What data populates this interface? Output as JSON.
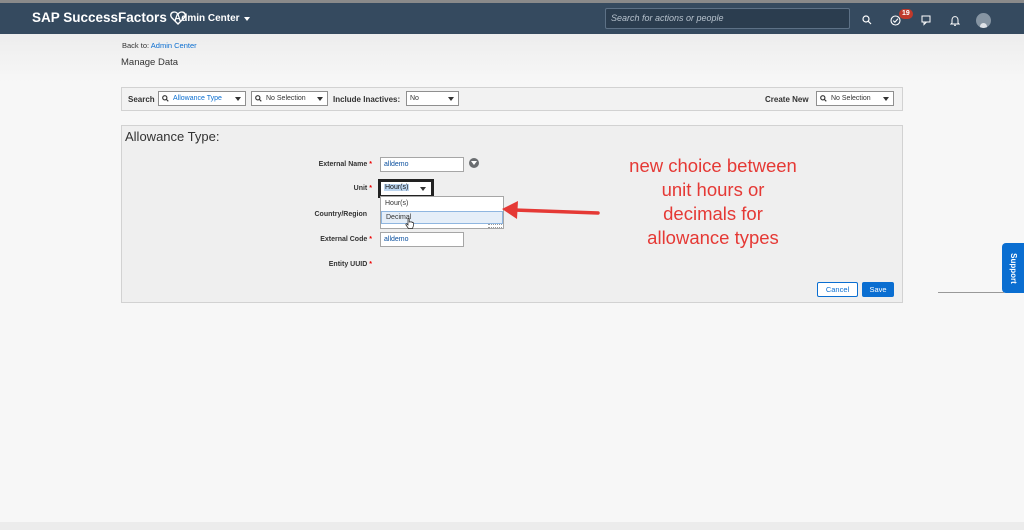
{
  "shellbar": {
    "logo_text": "SAP SuccessFactors",
    "module_menu": "Admin Center",
    "search_placeholder": "Search for actions or people",
    "notification_count": "19",
    "icons": [
      "search-icon",
      "approval-icon",
      "chat-icon",
      "bell-icon",
      "avatar"
    ]
  },
  "breadcrumb": {
    "prefix": "Back to: ",
    "link": "Admin Center"
  },
  "page_title": "Manage Data",
  "search_bar": {
    "search_label": "Search",
    "type_value": "Allowance Type",
    "selection_value": "No Selection",
    "include_inactives_label": "Include Inactives:",
    "include_inactives_value": "No",
    "create_new_label": "Create New",
    "create_new_value": "No Selection"
  },
  "form": {
    "title": "Allowance Type:",
    "fields": {
      "external_name": {
        "label": "External Name",
        "value": "alldemo"
      },
      "unit": {
        "label": "Unit",
        "value": "Hour(s)",
        "options": [
          "Hour(s)",
          "Decimal"
        ]
      },
      "country_region": {
        "label": "Country/Region"
      },
      "external_code": {
        "label": "External Code",
        "value": "alldemo"
      },
      "entity_uuid": {
        "label": "Entity UUID"
      }
    },
    "required_mark": "*",
    "cancel_label": "Cancel",
    "save_label": "Save"
  },
  "annotation": {
    "lines": [
      "new choice between",
      "unit hours or",
      "decimals for",
      "allowance types"
    ],
    "color": "#e53935"
  },
  "support_tab": "Support",
  "colors": {
    "shellbar": "#354a5f",
    "accent": "#0a6ed1"
  }
}
